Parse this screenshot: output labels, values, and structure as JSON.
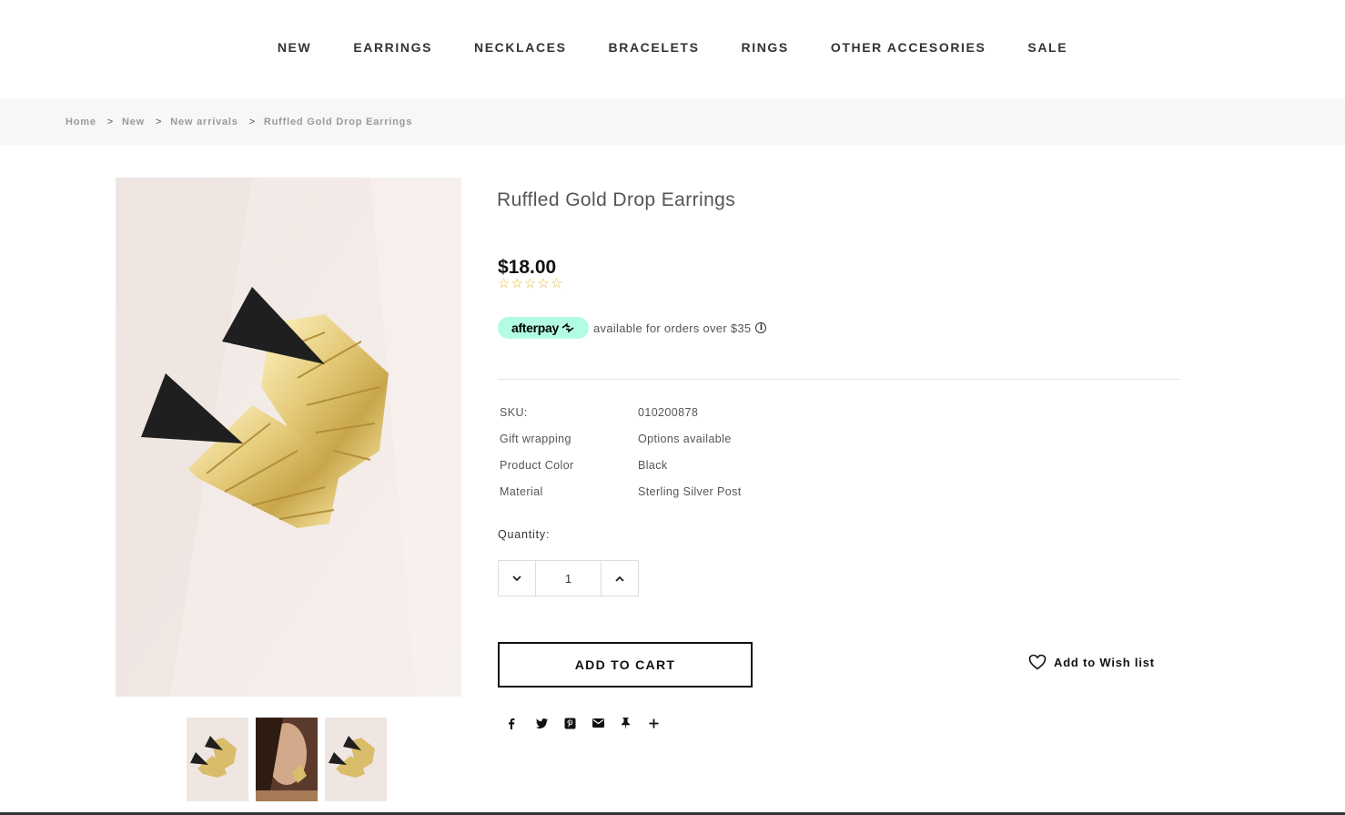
{
  "nav": {
    "items": [
      {
        "label": "NEW"
      },
      {
        "label": "EARRINGS"
      },
      {
        "label": "NECKLACES"
      },
      {
        "label": "BRACELETS"
      },
      {
        "label": "RINGS"
      },
      {
        "label": "OTHER ACCESORIES"
      },
      {
        "label": "SALE"
      }
    ]
  },
  "breadcrumb": {
    "items": [
      "Home",
      "New",
      "New arrivals",
      "Ruffled Gold Drop Earrings"
    ],
    "separator": ">"
  },
  "product": {
    "title": "Ruffled Gold Drop Earrings",
    "price": "$18.00",
    "rating": {
      "value": 0,
      "max": 5,
      "icon": "star-outline-icon"
    },
    "afterpay": {
      "badge": "afterpay",
      "text": "available for orders over $35",
      "info_icon": "i"
    },
    "specs": [
      {
        "key": "SKU:",
        "value": "010200878"
      },
      {
        "key": "Gift wrapping",
        "value": "Options available"
      },
      {
        "key": "Product Color",
        "value": "Black"
      },
      {
        "key": "Material",
        "value": "Sterling Silver Post"
      }
    ],
    "quantity": {
      "label": "Quantity:",
      "value": "1"
    },
    "add_to_cart": "ADD TO CART",
    "wishlist": "Add to Wish list",
    "share_icons": [
      "facebook-icon",
      "twitter-icon",
      "pinterest-icon",
      "email-icon",
      "pin-icon",
      "plus-icon"
    ]
  },
  "colors": {
    "afterpay_mint": "#b2fce4",
    "star": "#e8b92c",
    "breadcrumb_bg": "#f6f7f9"
  }
}
